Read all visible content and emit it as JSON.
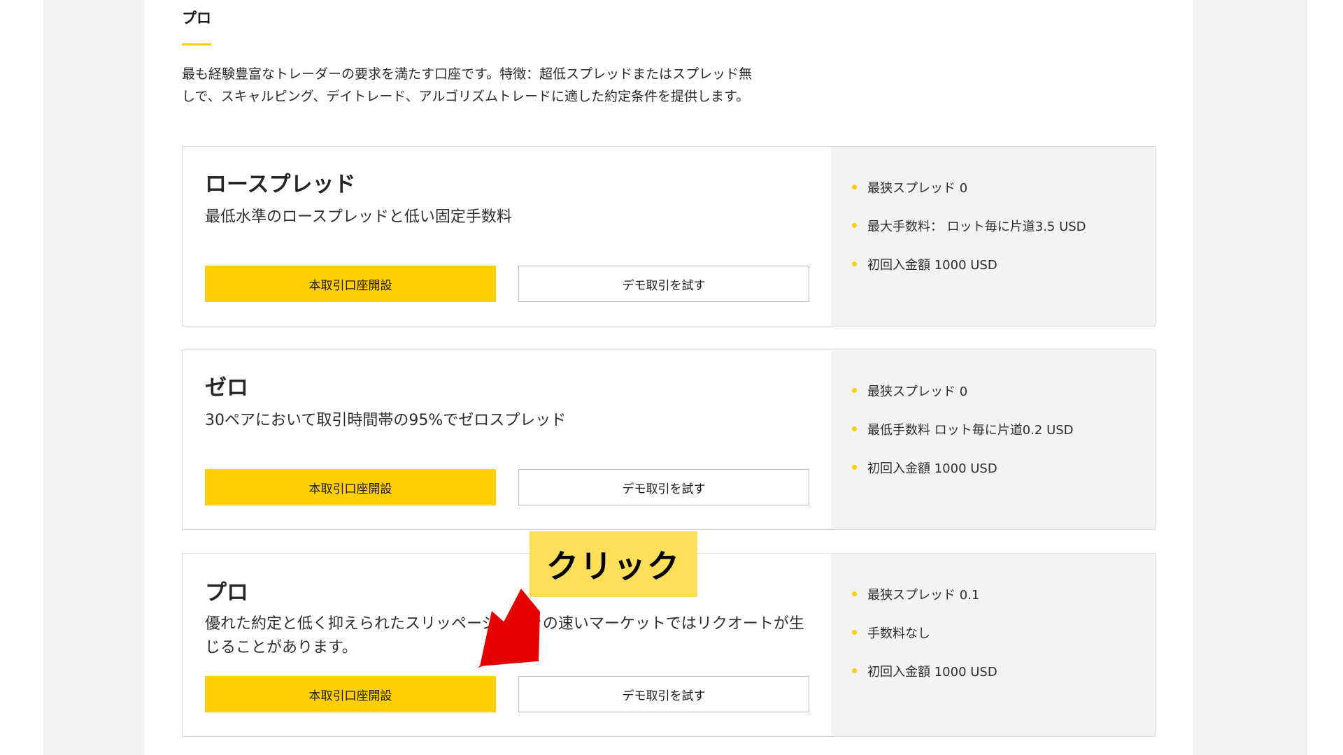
{
  "tab": {
    "title": "プロ"
  },
  "intro": {
    "line1": "最も経験豊富なトレーダーの要求を満たす口座です。特徴：超低スプレッドまたはスプレッド無",
    "line2": "しで、スキャルピング、デイトレード、アルゴリズムトレードに適した約定条件を提供します。"
  },
  "accounts": [
    {
      "name": "ロースプレッド",
      "description": "最低水準のロースプレッドと低い固定手数料",
      "primary_button": "本取引口座開設",
      "secondary_button": "デモ取引を試す",
      "features": [
        "最狭スプレッド 0",
        "最大手数料： ロット毎に片道3.5 USD",
        "初回入金額 1000 USD"
      ]
    },
    {
      "name": "ゼロ",
      "description": "30ペアにおいて取引時間帯の95%でゼロスプレッド",
      "primary_button": "本取引口座開設",
      "secondary_button": "デモ取引を試す",
      "features": [
        "最狭スプレッド 0",
        "最低手数料 ロット毎に片道0.2 USD",
        "初回入金額 1000 USD"
      ]
    },
    {
      "name": "プロ",
      "description": "優れた約定と低く抑えられたスリッページ。動きの速いマーケットではリクオートが生じることがあります。",
      "primary_button": "本取引口座開設",
      "secondary_button": "デモ取引を試す",
      "features": [
        "最狭スプレッド 0.1",
        "手数料なし",
        "初回入金額 1000 USD"
      ]
    }
  ],
  "annotation": {
    "label": "クリック"
  },
  "colors": {
    "accent": "#ffcf01",
    "callout": "#ffde59",
    "arrow": "#e50000"
  }
}
